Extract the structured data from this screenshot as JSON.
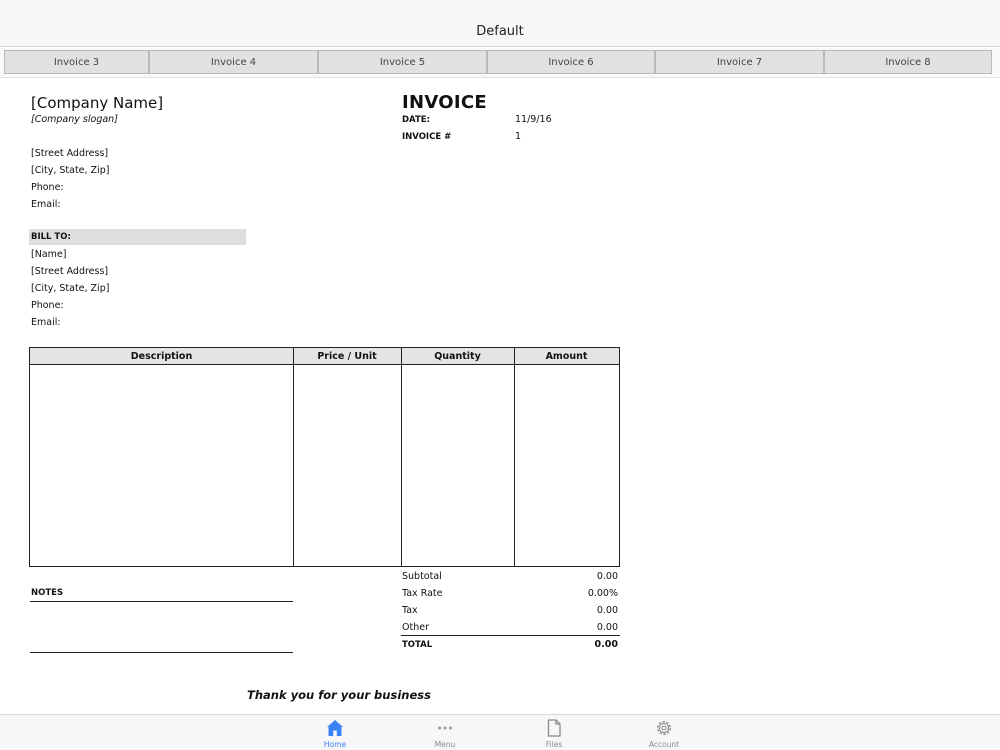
{
  "nav": {
    "title": "Default"
  },
  "tabs": [
    "Invoice 3",
    "Invoice 4",
    "Invoice 5",
    "Invoice 6",
    "Invoice 7",
    "Invoice 8"
  ],
  "company": {
    "name": "[Company Name]",
    "slogan": "[Company slogan]",
    "street": "[Street Address]",
    "city": "[City, State,  Zip]",
    "phone_label": "Phone:",
    "email_label": "Email:"
  },
  "invoice": {
    "title": "INVOICE",
    "date_label": "DATE:",
    "date_value": "11/9/16",
    "number_label": "INVOICE #",
    "number_value": "1"
  },
  "bill_to": {
    "header": "BILL TO:",
    "name": "[Name]",
    "street": "[Street Address]",
    "city": "[City, State,  Zip]",
    "phone_label": "Phone:",
    "email_label": "Email:"
  },
  "table": {
    "headers": [
      "Description",
      "Price / Unit",
      "Quantity",
      "Amount"
    ]
  },
  "notes": {
    "label": "NOTES"
  },
  "totals": {
    "subtotal_label": "Subtotal",
    "subtotal_value": "0.00",
    "tax_rate_label": "Tax Rate",
    "tax_rate_value": "0.00%",
    "tax_label": "Tax",
    "tax_value": "0.00",
    "other_label": "Other",
    "other_value": "0.00",
    "total_label": "TOTAL",
    "total_value": "0.00"
  },
  "footer": {
    "thanks": "Thank you for your business"
  },
  "tabbar": {
    "home": "Home",
    "menu": "Menu",
    "files": "Files",
    "account": "Account",
    "active_color": "#3b82f6",
    "inactive_color": "#8a8a8a"
  }
}
